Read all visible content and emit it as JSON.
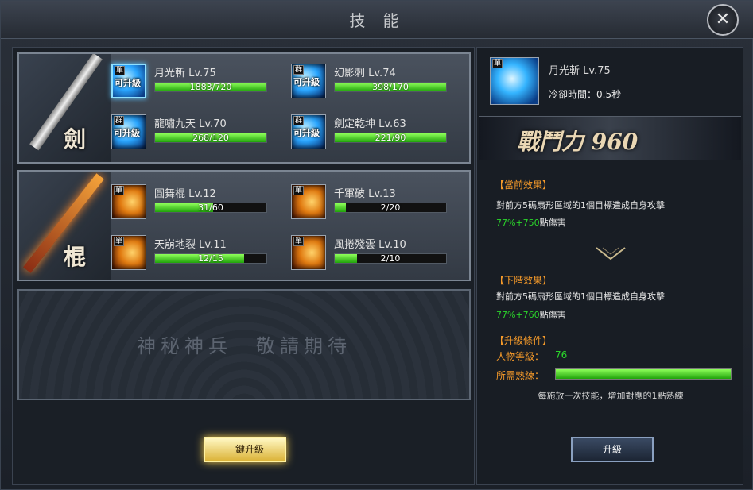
{
  "window": {
    "title": "技 能"
  },
  "groups": [
    {
      "label": "劍",
      "skills": [
        {
          "type": "單",
          "upgradable": "可升級",
          "name": "月光斬 Lv.75",
          "progress_text": "1883/720",
          "progress": 1.0,
          "color": "blue",
          "selected": true
        },
        {
          "type": "群",
          "upgradable": "可升級",
          "name": "幻影刺 Lv.74",
          "progress_text": "398/170",
          "progress": 1.0,
          "color": "blue"
        },
        {
          "type": "群",
          "upgradable": "可升級",
          "name": "龍嘯九天 Lv.70",
          "progress_text": "268/120",
          "progress": 1.0,
          "color": "blue"
        },
        {
          "type": "群",
          "upgradable": "可升級",
          "name": "劍定乾坤 Lv.63",
          "progress_text": "221/90",
          "progress": 1.0,
          "color": "blue"
        }
      ]
    },
    {
      "label": "棍",
      "skills": [
        {
          "type": "單",
          "upgradable": "",
          "name": "圓舞棍 Lv.12",
          "progress_text": "31/60",
          "progress": 0.52,
          "color": "orange"
        },
        {
          "type": "單",
          "upgradable": "",
          "name": "千軍破 Lv.13",
          "progress_text": "2/20",
          "progress": 0.1,
          "color": "orange"
        },
        {
          "type": "單",
          "upgradable": "",
          "name": "天崩地裂 Lv.11",
          "progress_text": "12/15",
          "progress": 0.8,
          "color": "orange"
        },
        {
          "type": "單",
          "upgradable": "",
          "name": "風捲殘雲 Lv.10",
          "progress_text": "2/10",
          "progress": 0.2,
          "color": "orange"
        }
      ]
    }
  ],
  "coming_soon": "神秘神兵　敬請期待",
  "one_click_upgrade": "一鍵升級",
  "detail": {
    "type": "單",
    "name": "月光斬 Lv.75",
    "cooldown_label": "冷卻時間：",
    "cooldown_value": "0.5秒",
    "power": "戰鬥力 960",
    "current_title": "【當前效果】",
    "current_desc": "對前方5碼扇形區域的1個目標造成自身攻擊",
    "current_dmg_green": "77%+750",
    "current_dmg_white": "點傷害",
    "next_title": "【下階效果】",
    "next_desc": "對前方5碼扇形區域的1個目標造成自身攻擊",
    "next_dmg_green": "77%+760",
    "next_dmg_white": "點傷害",
    "cond_title": "【升級條件】",
    "level_label": "人物等級：",
    "level_value": "76",
    "proficiency_label": "所需熟練：",
    "proficiency": 1.0,
    "hint": "每施放一次技能，增加對應的1點熟練",
    "upgrade_button": "升級"
  },
  "colors": {
    "bar_green": "#2fbf12",
    "section_orange": "#f59a2a",
    "value_green": "#2bd62b",
    "selected_glow": "#8fe0ff"
  }
}
